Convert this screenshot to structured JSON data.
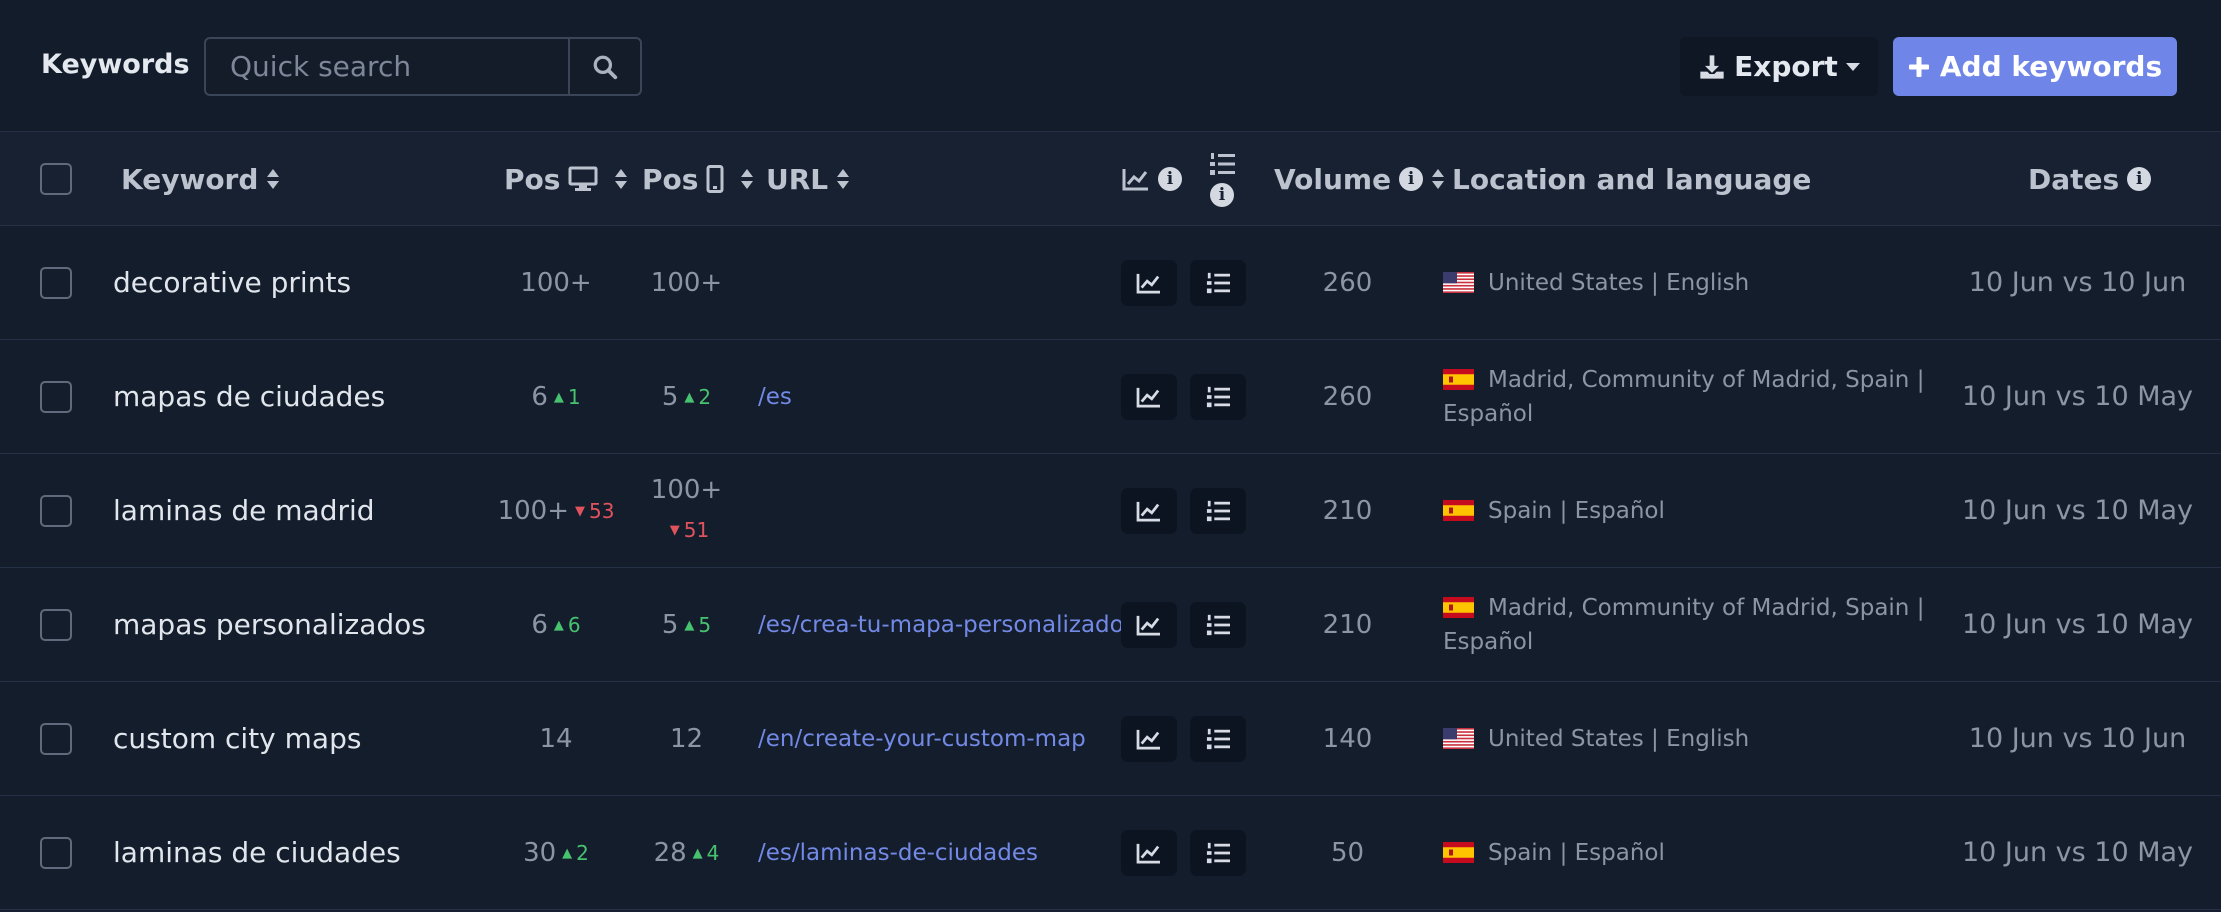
{
  "toolbar": {
    "title": "Keywords",
    "search_placeholder": "Quick search",
    "export_label": "Export",
    "add_label": "Add keywords"
  },
  "columns": {
    "keyword": "Keyword",
    "pos_desktop": "Pos",
    "pos_mobile": "Pos",
    "url": "URL",
    "volume": "Volume",
    "location": "Location and language",
    "dates": "Dates"
  },
  "rows": [
    {
      "keyword": "decorative prints",
      "pos_d": "100+",
      "pos_d_change": "",
      "pos_d_dir": "",
      "pos_m": "100+",
      "pos_m_change": "",
      "pos_m_dir": "",
      "url": "",
      "volume": "260",
      "flag": "us",
      "location": "United States | English",
      "dates": "10 Jun vs 10 Jun"
    },
    {
      "keyword": "mapas de ciudades",
      "pos_d": "6",
      "pos_d_change": "1",
      "pos_d_dir": "up",
      "pos_m": "5",
      "pos_m_change": "2",
      "pos_m_dir": "up",
      "url": "/es",
      "volume": "260",
      "flag": "es",
      "location": "Madrid, Community of Madrid, Spain | Español",
      "dates": "10 Jun vs 10 May"
    },
    {
      "keyword": "laminas de madrid",
      "pos_d": "100+",
      "pos_d_change": "53",
      "pos_d_dir": "down",
      "pos_m": "100+",
      "pos_m_change": "51",
      "pos_m_dir": "down",
      "url": "",
      "volume": "210",
      "flag": "es",
      "location": "Spain | Español",
      "dates": "10 Jun vs 10 May"
    },
    {
      "keyword": "mapas personalizados",
      "pos_d": "6",
      "pos_d_change": "6",
      "pos_d_dir": "up",
      "pos_m": "5",
      "pos_m_change": "5",
      "pos_m_dir": "up",
      "url": "/es/crea-tu-mapa-personalizado",
      "volume": "210",
      "flag": "es",
      "location": "Madrid, Community of Madrid, Spain | Español",
      "dates": "10 Jun vs 10 May"
    },
    {
      "keyword": "custom city maps",
      "pos_d": "14",
      "pos_d_change": "",
      "pos_d_dir": "",
      "pos_m": "12",
      "pos_m_change": "",
      "pos_m_dir": "",
      "url": "/en/create-your-custom-map",
      "volume": "140",
      "flag": "us",
      "location": "United States | English",
      "dates": "10 Jun vs 10 Jun"
    },
    {
      "keyword": "laminas de ciudades",
      "pos_d": "30",
      "pos_d_change": "2",
      "pos_d_dir": "up",
      "pos_m": "28",
      "pos_m_change": "4",
      "pos_m_dir": "up",
      "url": "/es/laminas-de-ciudades",
      "volume": "50",
      "flag": "es",
      "location": "Spain | Español",
      "dates": "10 Jun vs 10 May"
    }
  ],
  "colors": {
    "accent": "#6f86e8",
    "up": "#47c26f",
    "down": "#e0535d",
    "link": "#7389e6"
  }
}
